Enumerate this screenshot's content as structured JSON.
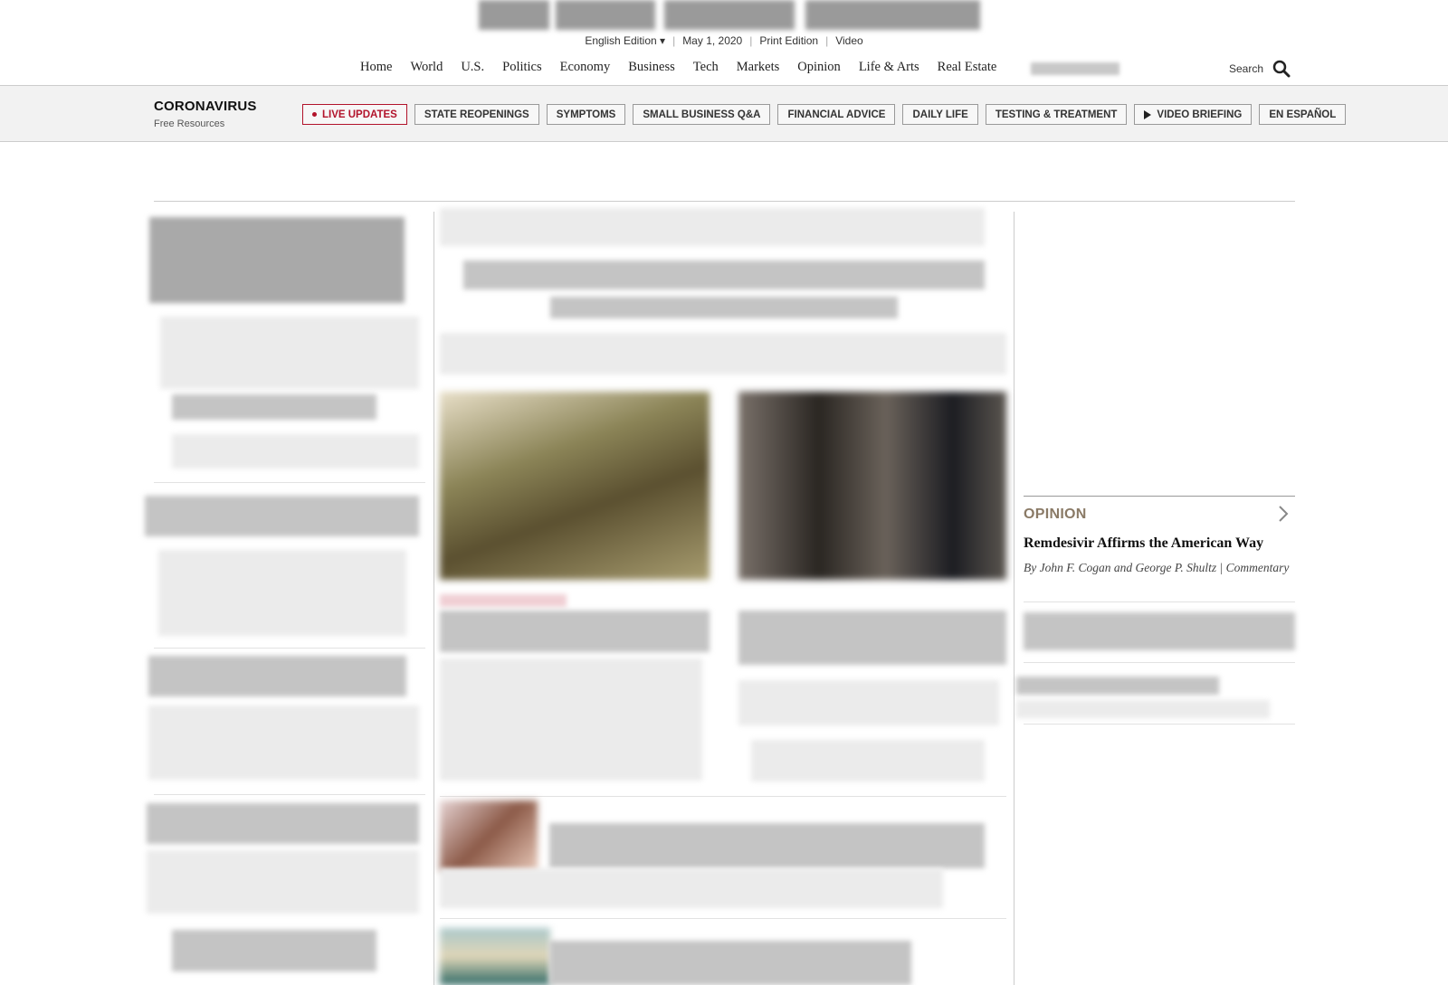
{
  "edition": {
    "selector": "English Edition ▾",
    "date": "May 1, 2020",
    "print": "Print Edition",
    "video": "Video"
  },
  "nav": {
    "items": [
      "Home",
      "World",
      "U.S.",
      "Politics",
      "Economy",
      "Business",
      "Tech",
      "Markets",
      "Opinion",
      "Life & Arts",
      "Real Estate"
    ],
    "search_label": "Search"
  },
  "coronavirus": {
    "title": "CORONAVIRUS",
    "subtitle": "Free Resources",
    "pills": [
      "LIVE UPDATES",
      "STATE REOPENINGS",
      "SYMPTOMS",
      "SMALL BUSINESS Q&A",
      "FINANCIAL ADVICE",
      "DAILY LIFE",
      "TESTING & TREATMENT",
      "VIDEO BRIEFING",
      "EN ESPAÑOL"
    ],
    "live_color": "#b2132b"
  },
  "opinion": {
    "label": "OPINION",
    "headline": "Remdesivir Affirms the American Way",
    "byline": "By John F. Cogan and George P. Shultz | Commentary",
    "label_color": "#8a7a66"
  },
  "icons": {
    "search": "search-icon",
    "chevron": "chevron-right-icon",
    "play": "play-icon"
  }
}
